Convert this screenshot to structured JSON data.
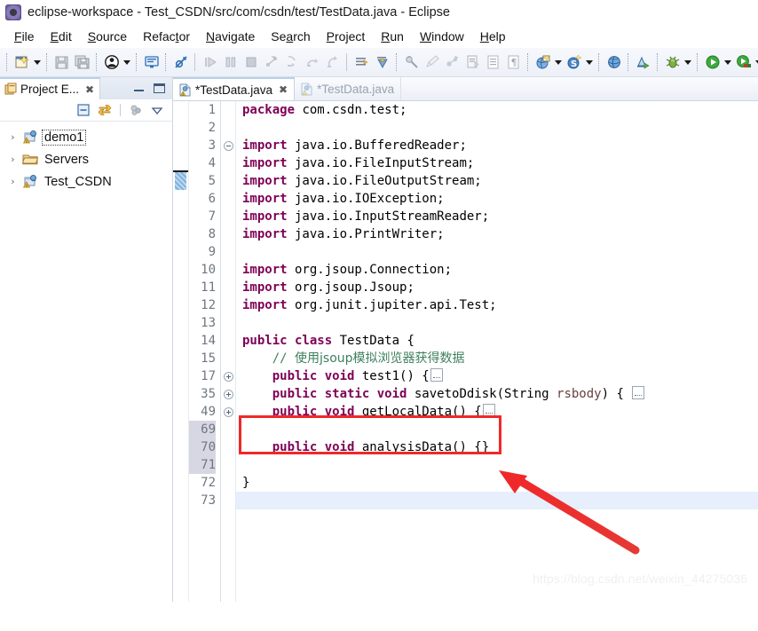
{
  "window": {
    "title": "eclipse-workspace - Test_CSDN/src/com/csdn/test/TestData.java - Eclipse",
    "app_icon": "eclipse-icon"
  },
  "menubar": {
    "items": [
      {
        "label": "File",
        "mnemonic": "F"
      },
      {
        "label": "Edit",
        "mnemonic": "E"
      },
      {
        "label": "Source",
        "mnemonic": "S"
      },
      {
        "label": "Refactor",
        "mnemonic": "t"
      },
      {
        "label": "Navigate",
        "mnemonic": "N"
      },
      {
        "label": "Search",
        "mnemonic": "a"
      },
      {
        "label": "Project",
        "mnemonic": "P"
      },
      {
        "label": "Run",
        "mnemonic": "R"
      },
      {
        "label": "Window",
        "mnemonic": "W"
      },
      {
        "label": "Help",
        "mnemonic": "H"
      }
    ]
  },
  "toolbar": {
    "buttons": [
      {
        "name": "new-wizard-icon",
        "tooltip": "New"
      },
      {
        "name": "new-wizard-dropdown-icon",
        "tooltip": "New dropdown"
      },
      {
        "name": "save-icon",
        "tooltip": "Save"
      },
      {
        "name": "save-all-icon",
        "tooltip": "Save All"
      },
      {
        "name": "user-icon",
        "tooltip": "User"
      },
      {
        "name": "user-dropdown-icon",
        "tooltip": "User dropdown"
      },
      {
        "name": "console-icon",
        "tooltip": "Open Console"
      },
      {
        "name": "skip-breakpoints-icon",
        "tooltip": "Skip All Breakpoints"
      },
      {
        "name": "resume-icon",
        "tooltip": "Resume"
      },
      {
        "name": "suspend-icon",
        "tooltip": "Suspend"
      },
      {
        "name": "terminate-icon",
        "tooltip": "Terminate"
      },
      {
        "name": "disconnect-icon",
        "tooltip": "Disconnect"
      },
      {
        "name": "step-into-icon",
        "tooltip": "Step Into"
      },
      {
        "name": "step-over-icon",
        "tooltip": "Step Over"
      },
      {
        "name": "step-return-icon",
        "tooltip": "Step Return"
      },
      {
        "name": "next-annotation-icon",
        "tooltip": "Next Annotation"
      },
      {
        "name": "previous-annotation-icon",
        "tooltip": "Previous Annotation"
      },
      {
        "name": "toggle-mark-occurrences-icon",
        "tooltip": "Toggle Mark Occurrences"
      },
      {
        "name": "pencil-icon",
        "tooltip": "Edit"
      },
      {
        "name": "link-icon",
        "tooltip": "Link"
      },
      {
        "name": "open-task-icon",
        "tooltip": "Open Task"
      },
      {
        "name": "toggle-block-selection-icon",
        "tooltip": "Toggle Block Selection"
      },
      {
        "name": "show-whitespace-icon",
        "tooltip": "Show Whitespace Characters"
      },
      {
        "name": "new-java-project-icon",
        "tooltip": "New Java Project"
      },
      {
        "name": "new-java-project-dropdown-icon",
        "tooltip": "New Java Project dropdown"
      },
      {
        "name": "new-package-icon",
        "tooltip": "New Java Package"
      },
      {
        "name": "new-package-dropdown-icon",
        "tooltip": "New Java Package dropdown"
      },
      {
        "name": "open-type-icon",
        "tooltip": "Open Type"
      },
      {
        "name": "search-type-icon",
        "tooltip": "Search"
      },
      {
        "name": "debug-icon",
        "tooltip": "Debug"
      },
      {
        "name": "debug-dropdown-icon",
        "tooltip": "Debug dropdown"
      },
      {
        "name": "run-icon",
        "tooltip": "Run"
      },
      {
        "name": "run-dropdown-icon",
        "tooltip": "Run dropdown"
      },
      {
        "name": "run-external-tools-icon",
        "tooltip": "External Tools"
      },
      {
        "name": "run-external-tools-dropdown-icon",
        "tooltip": "External Tools dropdown"
      },
      {
        "name": "coverage-icon",
        "tooltip": "Coverage"
      }
    ]
  },
  "project_explorer": {
    "tab_label": "Project E...",
    "tab_icon": "project-explorer-icon",
    "close_icon": "close-icon",
    "minimize_icon": "minimize-icon",
    "maximize_icon": "maximize-icon",
    "view_toolbar": [
      {
        "name": "collapse-all-icon"
      },
      {
        "name": "link-with-editor-icon"
      },
      {
        "name": "focus-on-active-task-icon"
      },
      {
        "name": "view-menu-icon"
      }
    ],
    "tree": [
      {
        "label": "demo1",
        "icon": "java-project-warning-icon",
        "expanded": false,
        "selected": true
      },
      {
        "label": "Servers",
        "icon": "folder-icon",
        "expanded": false,
        "selected": false
      },
      {
        "label": "Test_CSDN",
        "icon": "java-project-warning-icon",
        "expanded": false,
        "selected": false
      }
    ]
  },
  "editor": {
    "tabs": [
      {
        "label": "*TestData.java",
        "active": true,
        "icon": "java-file-warning-icon",
        "closable": true
      },
      {
        "label": "*TestData.java",
        "active": false,
        "icon": "java-file-warning-icon",
        "closable": false
      }
    ],
    "lines": [
      {
        "num": "1",
        "fold": "",
        "marker": "",
        "tokens": [
          {
            "t": "kw",
            "v": "package"
          },
          {
            "t": "plain",
            "v": " com.csdn.test;"
          }
        ]
      },
      {
        "num": "2",
        "fold": "",
        "marker": "",
        "tokens": []
      },
      {
        "num": "3",
        "fold": "minus",
        "marker": "",
        "tokens": [
          {
            "t": "kw",
            "v": "import"
          },
          {
            "t": "plain",
            "v": " java.io.BufferedReader;"
          }
        ]
      },
      {
        "num": "4",
        "fold": "",
        "marker": "",
        "tokens": [
          {
            "t": "kw",
            "v": "import"
          },
          {
            "t": "plain",
            "v": " java.io.FileInputStream;"
          }
        ]
      },
      {
        "num": "5",
        "fold": "",
        "marker": "",
        "tokens": [
          {
            "t": "kw",
            "v": "import"
          },
          {
            "t": "plain",
            "v": " java.io.FileOutputStream;"
          }
        ]
      },
      {
        "num": "6",
        "fold": "",
        "marker": "",
        "tokens": [
          {
            "t": "kw",
            "v": "import"
          },
          {
            "t": "plain",
            "v": " java.io.IOException;"
          }
        ]
      },
      {
        "num": "7",
        "fold": "",
        "marker": "",
        "tokens": [
          {
            "t": "kw",
            "v": "import"
          },
          {
            "t": "plain",
            "v": " java.io.InputStreamReader;"
          }
        ]
      },
      {
        "num": "8",
        "fold": "",
        "marker": "",
        "tokens": [
          {
            "t": "kw",
            "v": "import"
          },
          {
            "t": "plain",
            "v": " java.io.PrintWriter;"
          }
        ]
      },
      {
        "num": "9",
        "fold": "",
        "marker": "",
        "tokens": []
      },
      {
        "num": "10",
        "fold": "",
        "marker": "",
        "tokens": [
          {
            "t": "kw",
            "v": "import"
          },
          {
            "t": "plain",
            "v": " org.jsoup.Connection;"
          }
        ]
      },
      {
        "num": "11",
        "fold": "",
        "marker": "",
        "tokens": [
          {
            "t": "kw",
            "v": "import"
          },
          {
            "t": "plain",
            "v": " org.jsoup.Jsoup;"
          }
        ]
      },
      {
        "num": "12",
        "fold": "",
        "marker": "",
        "tokens": [
          {
            "t": "kw",
            "v": "import"
          },
          {
            "t": "plain",
            "v": " org.junit.jupiter.api.Test;"
          }
        ]
      },
      {
        "num": "13",
        "fold": "",
        "marker": "",
        "tokens": []
      },
      {
        "num": "14",
        "fold": "",
        "marker": "",
        "tokens": [
          {
            "t": "kw",
            "v": "public class"
          },
          {
            "t": "plain",
            "v": " TestData {"
          }
        ]
      },
      {
        "num": "15",
        "fold": "",
        "marker": "",
        "tokens": [
          {
            "t": "cmt",
            "v": "    // "
          },
          {
            "t": "cmt-cn",
            "v": "使用jsoup模拟浏览器获得数据"
          }
        ]
      },
      {
        "num": "17",
        "fold": "plus",
        "marker": "method",
        "tokens": [
          {
            "t": "kw",
            "v": "    public void"
          },
          {
            "t": "plain",
            "v": " test1() {"
          },
          {
            "t": "foldph",
            "v": ""
          }
        ]
      },
      {
        "num": "35",
        "fold": "plus",
        "marker": "method",
        "tokens": [
          {
            "t": "kw",
            "v": "    public static void"
          },
          {
            "t": "plain",
            "v": " savetoDdisk(String "
          },
          {
            "t": "param",
            "v": "rsbody"
          },
          {
            "t": "plain",
            "v": ") { "
          },
          {
            "t": "foldph",
            "v": ""
          }
        ]
      },
      {
        "num": "49",
        "fold": "plus",
        "marker": "method",
        "tokens": [
          {
            "t": "kw",
            "v": "    public void"
          },
          {
            "t": "plain",
            "v": " getLocalData() {"
          },
          {
            "t": "foldph",
            "v": ""
          }
        ]
      },
      {
        "num": "69",
        "fold": "",
        "marker": "",
        "tokens": []
      },
      {
        "num": "70",
        "fold": "",
        "marker": "",
        "tokens": [
          {
            "t": "kw",
            "v": "    public void"
          },
          {
            "t": "plain",
            "v": " analysisData() {}"
          }
        ]
      },
      {
        "num": "71",
        "fold": "",
        "marker": "",
        "tokens": []
      },
      {
        "num": "72",
        "fold": "",
        "marker": "",
        "tokens": [
          {
            "t": "plain",
            "v": "}"
          }
        ]
      },
      {
        "num": "73",
        "fold": "",
        "marker": "",
        "tokens": [],
        "current": true
      }
    ]
  },
  "annotations": {
    "highlight_box": {
      "label": "red-rectangle-highlight",
      "color": "#ef2929"
    },
    "arrow": {
      "label": "red-arrow-pointer",
      "color": "#ef2929"
    }
  },
  "watermark": {
    "text": "https://blog.csdn.net/weixin_44275036"
  },
  "colors": {
    "keyword": "#7f0055",
    "comment": "#3f7f5f",
    "parameter": "#6a3e3e",
    "line_number": "#6e7781",
    "current_line": "#e6effb",
    "annotation_red": "#ef2929"
  }
}
